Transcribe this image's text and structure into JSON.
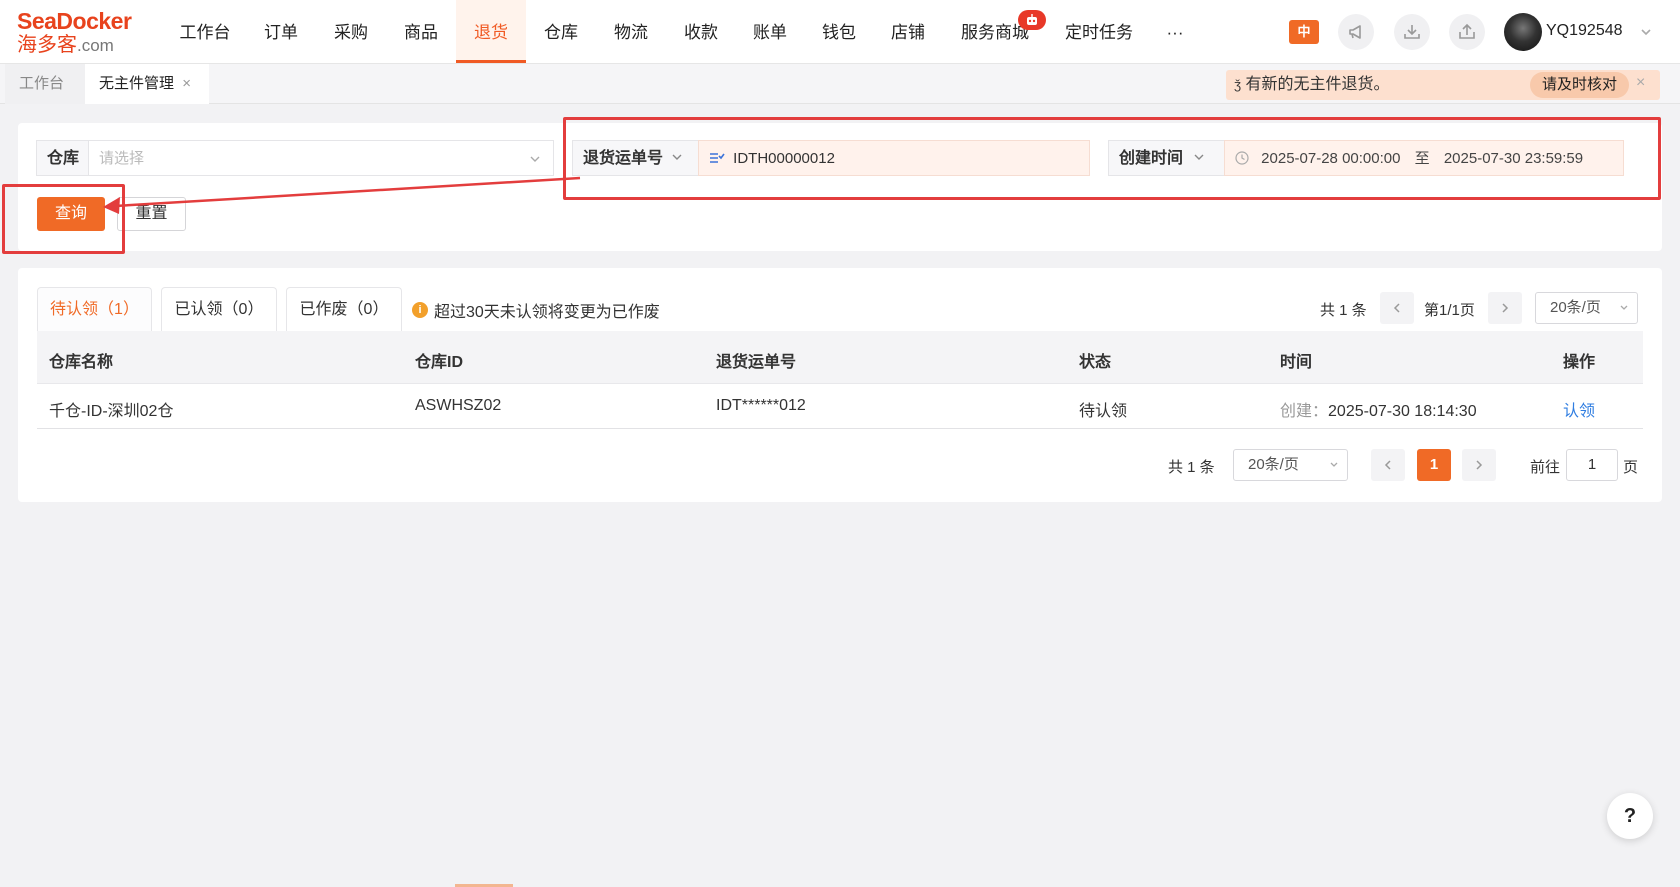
{
  "logo": {
    "brand_en": "SeaDocker",
    "brand_cn": "海多客",
    "domain": ".com"
  },
  "nav": {
    "items": [
      "工作台",
      "订单",
      "采购",
      "商品",
      "退货",
      "仓库",
      "物流",
      "收款",
      "账单",
      "钱包",
      "店铺",
      "服务商城",
      "定时任务",
      "···"
    ],
    "active": "退货",
    "badge_icon": "robot-icon"
  },
  "header": {
    "lang": "中",
    "username": "YQ192548"
  },
  "tabs": {
    "items": [
      "工作台",
      "无主件管理"
    ],
    "active": "无主件管理",
    "close": "×"
  },
  "notice": {
    "text": "有新的无主件退货。",
    "button": "请及时核对",
    "close": "×"
  },
  "filters": {
    "warehouse_label": "仓库",
    "warehouse_placeholder": "请选择",
    "return_no_label": "退货运单号",
    "return_no_value": "IDTH00000012",
    "time_label": "创建时间",
    "time_start": "2025-07-28 00:00:00",
    "time_sep": "至",
    "time_end": "2025-07-30 23:59:59",
    "query_button": "查询",
    "reset_button": "重置"
  },
  "list": {
    "tabs": [
      "待认领（1）",
      "已认领（0）",
      "已作废（0）"
    ],
    "active_tab": "待认领（1）",
    "hint": "超过30天未认领将变更为已作废",
    "pager_top": {
      "total": "共 1 条",
      "page": "第1/1页",
      "size": "20条/页"
    },
    "columns": [
      "仓库名称",
      "仓库ID",
      "退货运单号",
      "状态",
      "时间",
      "操作"
    ],
    "rows": [
      {
        "warehouse": "千仓-ID-深圳02仓",
        "warehouse_id": "ASWHSZ02",
        "return_no": "IDT******012",
        "status": "待认领",
        "time_label": "创建：",
        "time": "2025-07-30 18:14:30",
        "action": "认领"
      }
    ],
    "pager_bottom": {
      "total": "共 1 条",
      "size": "20条/页",
      "current": "1",
      "goto_label": "前往",
      "goto_value": "1",
      "goto_suffix": "页"
    }
  },
  "help": "?",
  "colors": {
    "accent": "#f06a26",
    "annotation": "#e33d3d",
    "link": "#2f7de1"
  }
}
